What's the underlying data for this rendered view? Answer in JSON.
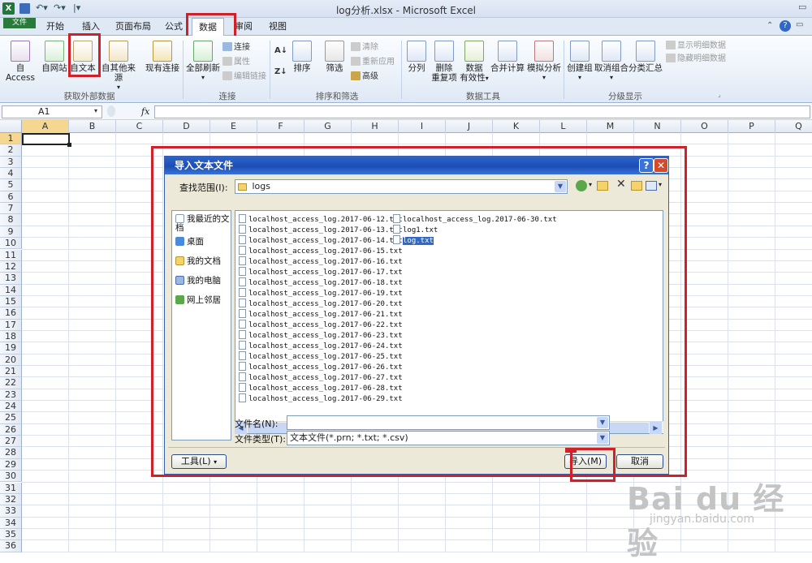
{
  "app": {
    "window_title": "log分析.xlsx - Microsoft Excel",
    "excel_logo": "X"
  },
  "tabs": [
    {
      "label": "文件"
    },
    {
      "label": "开始"
    },
    {
      "label": "插入"
    },
    {
      "label": "页面布局"
    },
    {
      "label": "公式"
    },
    {
      "label": "数据"
    },
    {
      "label": "审阅"
    },
    {
      "label": "视图"
    }
  ],
  "ribbon": {
    "get_external": {
      "access": "自 Access",
      "web": "自网站",
      "text": "自文本",
      "other": "自其他来源",
      "existing": "现有连接",
      "group": "获取外部数据"
    },
    "connections": {
      "refresh_all": "全部刷新",
      "connections": "连接",
      "properties": "属性",
      "edit_links": "编辑链接",
      "group": "连接"
    },
    "sort_filter": {
      "sort": "排序",
      "filter": "筛选",
      "clear": "清除",
      "reapply": "重新应用",
      "advanced": "高级",
      "group": "排序和筛选"
    },
    "data_tools": {
      "text_to_columns": "分列",
      "remove_dup_1": "删除",
      "remove_dup_2": "重复项",
      "validation_1": "数据",
      "validation_2": "有效性",
      "consolidate": "合并计算",
      "whatif": "模拟分析",
      "group": "数据工具"
    },
    "outline": {
      "group_btn": "创建组",
      "ungroup": "取消组合",
      "subtotal": "分类汇总",
      "show_detail": "显示明细数据",
      "hide_detail": "隐藏明细数据",
      "group": "分级显示"
    }
  },
  "formula_bar": {
    "name_box": "A1",
    "fx": "fx"
  },
  "columns": [
    "A",
    "B",
    "C",
    "D",
    "E",
    "F",
    "G",
    "H",
    "I",
    "J",
    "K",
    "L",
    "M",
    "N",
    "O",
    "P",
    "Q"
  ],
  "rows": [
    "1",
    "2",
    "3",
    "4",
    "5",
    "6",
    "7",
    "8",
    "9",
    "10",
    "11",
    "12",
    "13",
    "14",
    "15",
    "16",
    "17",
    "18",
    "19",
    "20",
    "21",
    "22",
    "23",
    "24",
    "25",
    "26",
    "27",
    "28",
    "29",
    "30",
    "31",
    "32",
    "33",
    "34",
    "35",
    "36"
  ],
  "dialog": {
    "title": "导入文本文件",
    "help": "?",
    "close": "✕",
    "look_in_label": "查找范围(I):",
    "look_in_value": "logs",
    "places": [
      {
        "label": "我最近的文档",
        "icon": "recent-docs-icon"
      },
      {
        "label": "桌面",
        "icon": "desktop-icon"
      },
      {
        "label": "我的文档",
        "icon": "my-documents-icon"
      },
      {
        "label": "我的电脑",
        "icon": "my-computer-icon"
      },
      {
        "label": "网上邻居",
        "icon": "network-icon"
      }
    ],
    "files_col1": [
      "localhost_access_log.2017-06-12.txt",
      "localhost_access_log.2017-06-13.txt",
      "localhost_access_log.2017-06-14.txt",
      "localhost_access_log.2017-06-15.txt",
      "localhost_access_log.2017-06-16.txt",
      "localhost_access_log.2017-06-17.txt",
      "localhost_access_log.2017-06-18.txt",
      "localhost_access_log.2017-06-19.txt",
      "localhost_access_log.2017-06-20.txt",
      "localhost_access_log.2017-06-21.txt",
      "localhost_access_log.2017-06-22.txt",
      "localhost_access_log.2017-06-23.txt",
      "localhost_access_log.2017-06-24.txt",
      "localhost_access_log.2017-06-25.txt",
      "localhost_access_log.2017-06-26.txt",
      "localhost_access_log.2017-06-27.txt",
      "localhost_access_log.2017-06-28.txt",
      "localhost_access_log.2017-06-29.txt"
    ],
    "files_col2": [
      "localhost_access_log.2017-06-30.txt",
      "log1.txt",
      "log.txt"
    ],
    "selected_file": "log.txt",
    "filename_label": "文件名(N):",
    "filename_value": "",
    "filetype_label": "文件类型(T):",
    "filetype_value": "文本文件(*.prn; *.txt; *.csv)",
    "tools_button": "工具(L)",
    "import_button": "导入(M)",
    "cancel_button": "取消"
  },
  "watermark": {
    "brand": "Bai du 经验",
    "url": "jingyan.baidu.com"
  },
  "colors": {
    "accent": "#1b4eb5",
    "highlight": "#d0202a",
    "file_tab": "#2a7a3c",
    "selection": "#316ac5"
  }
}
